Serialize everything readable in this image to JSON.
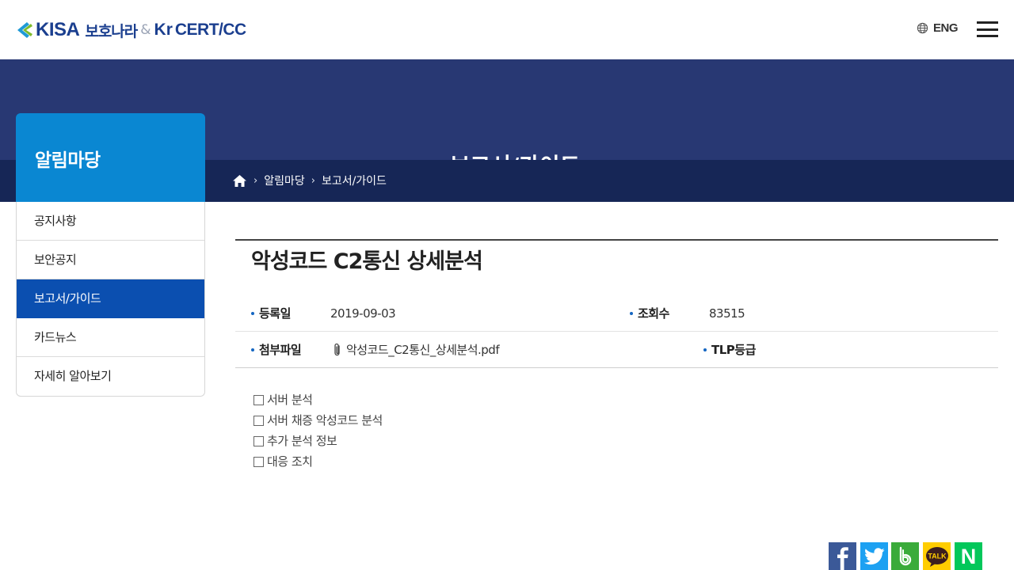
{
  "header": {
    "logo_kisa": "KISA",
    "logo_bohonara": "보호나라",
    "logo_amp": "&",
    "logo_kr": "Kr",
    "logo_cert": "CERT/CC",
    "lang_label": "ENG"
  },
  "hero": {
    "title": "보고서/가이드"
  },
  "breadcrumb": {
    "items": [
      "알림마당",
      "보고서/가이드"
    ],
    "separator": "›"
  },
  "sidebar": {
    "heading": "알림마당",
    "items": [
      {
        "label": "공지사항"
      },
      {
        "label": "보안공지"
      },
      {
        "label": "보고서/가이드",
        "active": true
      },
      {
        "label": "카드뉴스"
      },
      {
        "label": "자세히 알아보기"
      }
    ]
  },
  "post": {
    "title": "악성코드 C2통신 상세분석",
    "date_label": "등록일",
    "date_value": "2019-09-03",
    "views_label": "조회수",
    "views_value": "83515",
    "attach_label": "첨부파일",
    "attach_value": "악성코드_C2통신_상세분석.pdf",
    "tlp_label": "TLP등급"
  },
  "toc": {
    "items": [
      "서버 분석",
      "서버 채증 악성코드 분석",
      "추가 분석 정보",
      "대응 조치"
    ]
  },
  "share": {
    "facebook": "facebook-icon",
    "twitter": "twitter-icon",
    "band": "band-icon",
    "kakaotalk_label": "TALK",
    "naver_label": "N"
  },
  "colors": {
    "brand": "#1b3f8f",
    "hero": "#283873",
    "breadcrumb_bar": "#162656",
    "side_head": "#0a87d2",
    "side_active": "#0b4fb0"
  }
}
